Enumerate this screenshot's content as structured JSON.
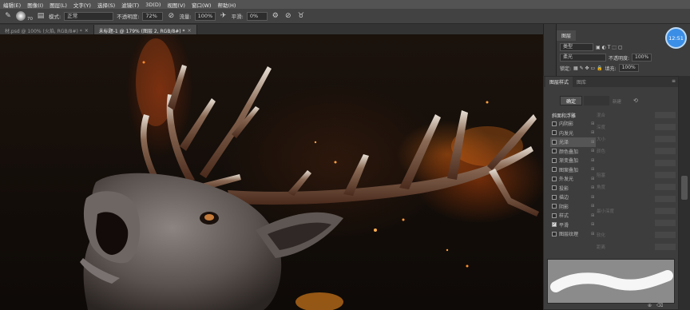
{
  "menubar": {
    "items": [
      "编辑(E)",
      "图像(I)",
      "图层(L)",
      "文字(Y)",
      "选择(S)",
      "滤镜(T)",
      "3D(D)",
      "视图(V)",
      "窗口(W)",
      "帮助(H)"
    ]
  },
  "options": {
    "brush_size": "70",
    "mode_label": "模式:",
    "mode_value": "正常",
    "opacity_label": "不透明度:",
    "opacity_value": "72%",
    "flow_label": "流量:",
    "flow_value": "100%",
    "smooth_label": "平滑:",
    "smooth_value": "0%"
  },
  "tabs": [
    {
      "label": "材.psd @ 100% (火焰, RGB/8#) *",
      "active": false
    },
    {
      "label": "未标题-1 @ 179% (图层 2, RGB/8#) *",
      "active": true
    }
  ],
  "clock": "12:51",
  "layers": {
    "tab": "图层",
    "kind": "类型",
    "blend": "柔光",
    "opacity_label": "不透明度:",
    "opacity": "100%",
    "lock_label": "锁定:",
    "fill_label": "填充:",
    "fill": "100%"
  },
  "dialog": {
    "tabs": [
      "图层样式",
      "图库"
    ],
    "ok": "确定",
    "aux": "新建",
    "header": "斜面和浮雕",
    "styles": [
      {
        "label": "内阴影",
        "checked": false,
        "selected": false
      },
      {
        "label": "内发光",
        "checked": false,
        "selected": false
      },
      {
        "label": "光泽",
        "checked": false,
        "selected": true
      },
      {
        "label": "颜色叠加",
        "checked": false,
        "selected": false
      },
      {
        "label": "渐变叠加",
        "checked": false,
        "selected": false
      },
      {
        "label": "图案叠加",
        "checked": false,
        "selected": false
      },
      {
        "label": "外发光",
        "checked": false,
        "selected": false
      },
      {
        "label": "投影",
        "checked": false,
        "selected": false
      },
      {
        "label": "描边",
        "checked": false,
        "selected": false
      },
      {
        "label": "阴影",
        "checked": false,
        "selected": false
      },
      {
        "label": "样式",
        "checked": false,
        "selected": false
      },
      {
        "label": "平滑",
        "checked": true,
        "selected": false
      },
      {
        "label": "图层纹理",
        "checked": false,
        "selected": false
      }
    ],
    "props": [
      "混合",
      "深度",
      "大小",
      "颜色",
      "",
      "阻塞",
      "角度",
      "",
      "最小深度",
      "",
      "软化",
      "距离"
    ]
  }
}
